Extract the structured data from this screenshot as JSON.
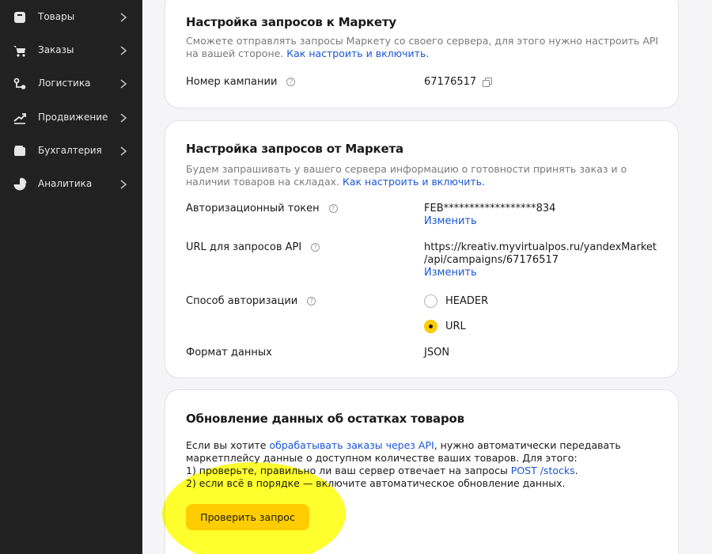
{
  "sidebar": {
    "items": [
      {
        "label": "Товары",
        "icon": "box-icon"
      },
      {
        "label": "Заказы",
        "icon": "cart-icon"
      },
      {
        "label": "Логистика",
        "icon": "route-icon"
      },
      {
        "label": "Продвижение",
        "icon": "trend-icon"
      },
      {
        "label": "Бухгалтерия",
        "icon": "wallet-icon"
      },
      {
        "label": "Аналитика",
        "icon": "pie-icon"
      }
    ]
  },
  "card1": {
    "title": "Настройка запросов к Маркету",
    "desc_text": "Сможете отправлять запросы Маркету со своего сервера, для этого нужно настроить API на вашей стороне. ",
    "desc_link": "Как настроить и включить.",
    "campaign_label": "Номер кампании",
    "campaign_value": "67176517"
  },
  "card2": {
    "title": "Настройка запросов от Маркета",
    "desc_text": "Будем запрашивать у вашего сервера информацию о готовности принять заказ и о наличии товаров на складах. ",
    "desc_link": "Как настроить и включить.",
    "token_label": "Авторизационный токен",
    "token_value": "FEB******************834",
    "token_change": "Изменить",
    "url_label": "URL для запросов API",
    "url_value_line1": "https://kreativ.myvirtualpos.ru/yandexMarket",
    "url_value_line2": "/api/campaigns/67176517",
    "url_change": "Изменить",
    "auth_label": "Способ авторизации",
    "auth_options": [
      {
        "label": "HEADER",
        "checked": false
      },
      {
        "label": "URL",
        "checked": true
      }
    ],
    "format_label": "Формат данных",
    "format_value": "JSON"
  },
  "card3": {
    "title": "Обновление данных об остатках товаров",
    "line1_pre": "Если вы хотите ",
    "line1_link": "обрабатывать заказы через API",
    "line1_post": ", нужно автоматически передавать",
    "line2": "маркетплейсу данные о доступном количестве ваших товаров. Для этого:",
    "line3_pre": "1) проверьте, правильно ли ваш сервер отвечает на запросы ",
    "line3_link": "POST /stocks",
    "line3_post": ".",
    "line4": "2) если всё в порядке — включите автоматическое обновление данных.",
    "button_label": "Проверить запрос"
  },
  "colors": {
    "accent": "#ffcc00",
    "link": "#1a55d6",
    "sidebar_bg": "#212121",
    "annotation_highlight": "#ffff00"
  }
}
